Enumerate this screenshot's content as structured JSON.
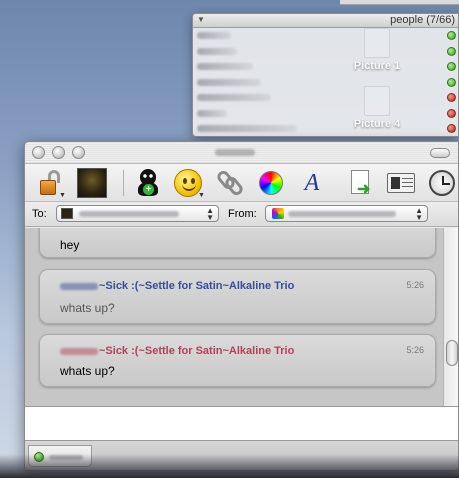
{
  "desktop": {
    "icons": [
      {
        "label": "Picture 1"
      },
      {
        "label": "Picture 4"
      }
    ]
  },
  "buddy_list": {
    "title": "people (7/66)",
    "buddies": [
      {
        "status": "online",
        "status_color": "#2f9c18"
      },
      {
        "status": "online",
        "status_color": "#2f9c18"
      },
      {
        "status": "online",
        "status_color": "#2f9c18"
      },
      {
        "status": "online",
        "status_color": "#2f9c18"
      },
      {
        "status": "away",
        "status_color": "#b8180f"
      },
      {
        "status": "away",
        "status_color": "#b8180f"
      },
      {
        "status": "away",
        "status_color": "#b8180f"
      }
    ]
  },
  "chat": {
    "toolbar": {
      "icons": [
        "lock-icon",
        "buddy-icon-image",
        "add-buddy-icon",
        "smiley-icon",
        "link-icon",
        "color-icon",
        "font-icon",
        "send-file-icon",
        "buddy-info-icon",
        "clock-icon"
      ]
    },
    "to_label": "To:",
    "from_label": "From:",
    "messages": [
      {
        "sender": "",
        "text": "hey",
        "time": "",
        "color": "#000000"
      },
      {
        "sender": "~Sick :(~Settle for Satin~Alkaline Trio",
        "text": "whats up?",
        "time": "5:26",
        "color": "#3a4c9a",
        "text_color": "#555555"
      },
      {
        "sender": "~Sick :(~Settle for Satin~Alkaline Trio",
        "text": "whats up?",
        "time": "5:26",
        "color": "#b0425a",
        "text_color": "#000000"
      }
    ]
  }
}
